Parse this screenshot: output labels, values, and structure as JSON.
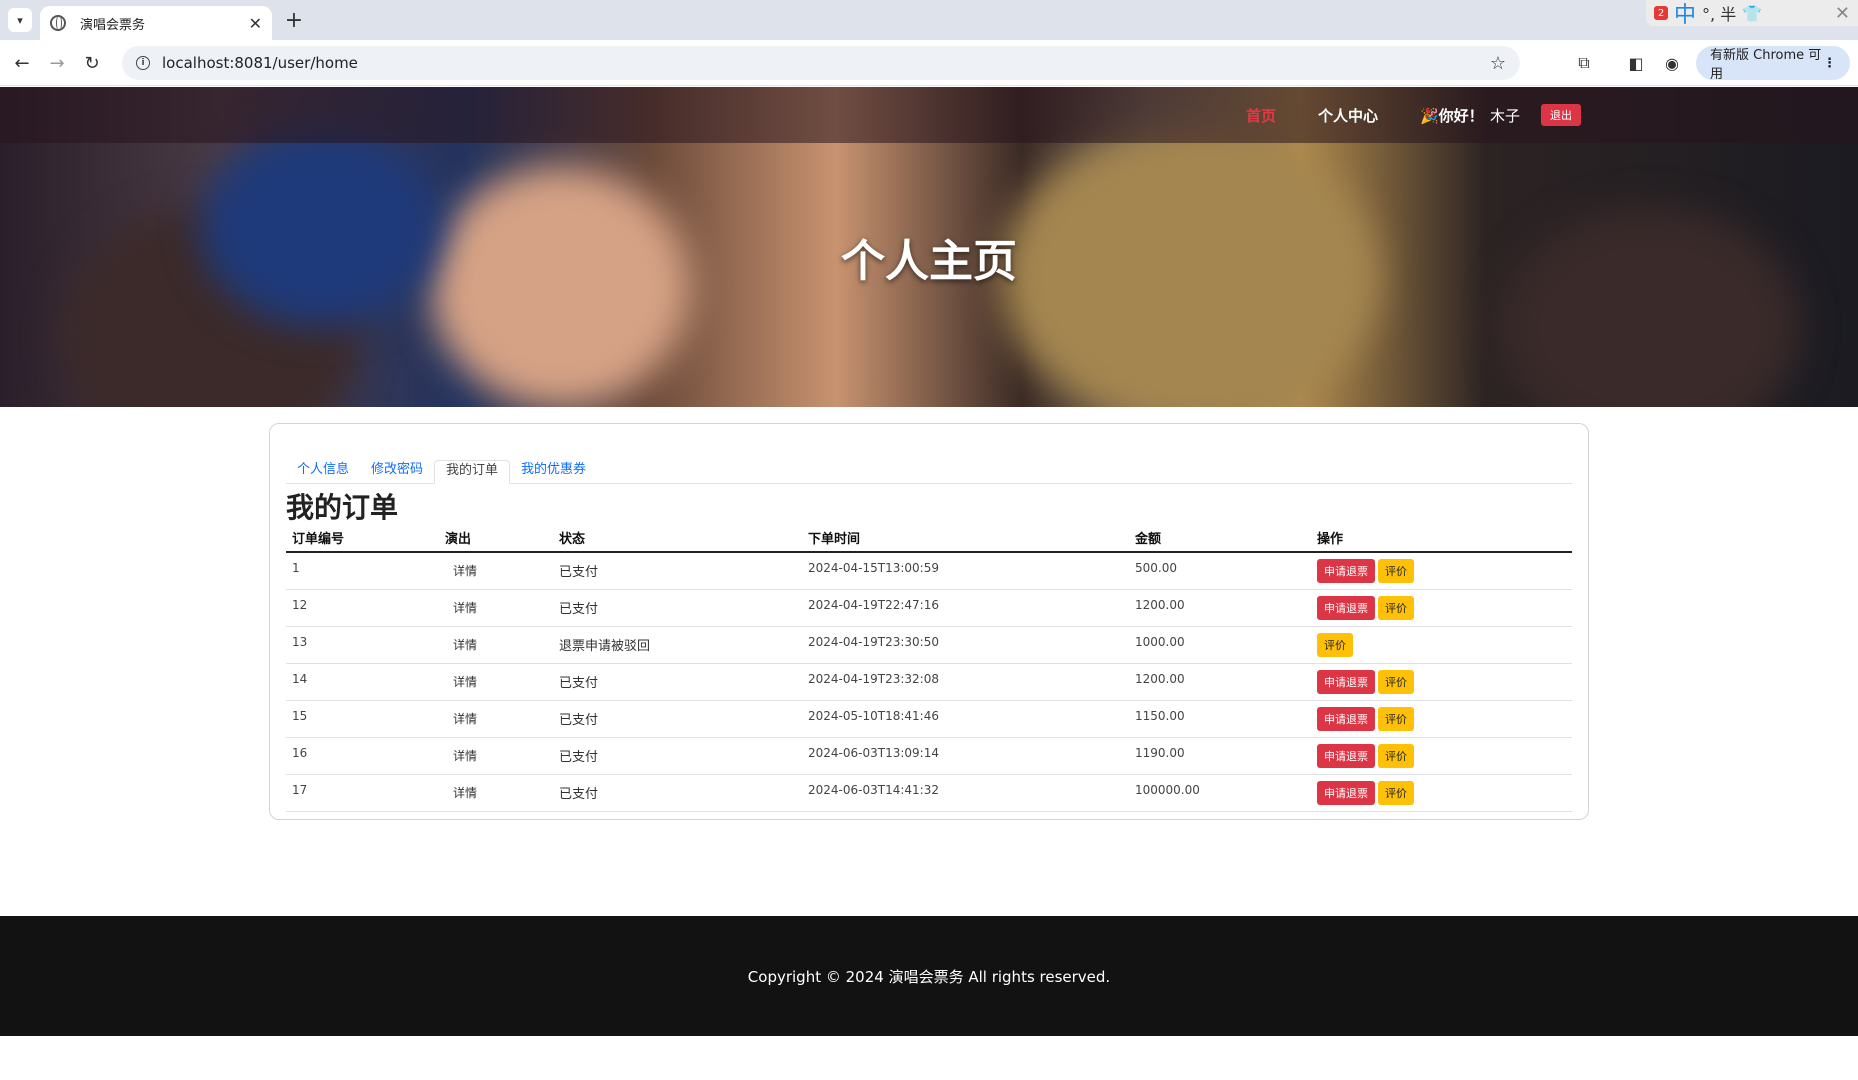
{
  "browser": {
    "tab_title": "演唱会票务",
    "url": "localhost:8081/user/home",
    "update_label": "有新版 Chrome 可用",
    "ime_badge": "2",
    "ime_text": "中",
    "ime_extra": "°, 半"
  },
  "nav": {
    "home": "首页",
    "center": "个人中心",
    "greeting": "🎉你好！",
    "username": "木子",
    "logout": "退出"
  },
  "hero": {
    "title": "个人主页"
  },
  "tabs": [
    {
      "label": "个人信息",
      "active": false
    },
    {
      "label": "修改密码",
      "active": false
    },
    {
      "label": "我的订单",
      "active": true
    },
    {
      "label": "我的优惠券",
      "active": false
    }
  ],
  "section_title": "我的订单",
  "table": {
    "headers": [
      "订单编号",
      "演出",
      "状态",
      "下单时间",
      "金额",
      "操作"
    ],
    "detail_label": "详情",
    "refund_label": "申请退票",
    "review_label": "评价",
    "rows": [
      {
        "id": "1",
        "status": "已支付",
        "time": "2024-04-15T13:00:59",
        "amount": "500.00",
        "refund": true
      },
      {
        "id": "12",
        "status": "已支付",
        "time": "2024-04-19T22:47:16",
        "amount": "1200.00",
        "refund": true
      },
      {
        "id": "13",
        "status": "退票申请被驳回",
        "time": "2024-04-19T23:30:50",
        "amount": "1000.00",
        "refund": false
      },
      {
        "id": "14",
        "status": "已支付",
        "time": "2024-04-19T23:32:08",
        "amount": "1200.00",
        "refund": true
      },
      {
        "id": "15",
        "status": "已支付",
        "time": "2024-05-10T18:41:46",
        "amount": "1150.00",
        "refund": true
      },
      {
        "id": "16",
        "status": "已支付",
        "time": "2024-06-03T13:09:14",
        "amount": "1190.00",
        "refund": true
      },
      {
        "id": "17",
        "status": "已支付",
        "time": "2024-06-03T14:41:32",
        "amount": "100000.00",
        "refund": true
      }
    ]
  },
  "footer": {
    "copyright": "Copyright © 2024 演唱会票务 All rights reserved."
  },
  "colors": {
    "accent_red": "#dc3545",
    "accent_yellow": "#ffc107",
    "link_blue": "#0d6efd",
    "footer_bg": "#121212"
  }
}
